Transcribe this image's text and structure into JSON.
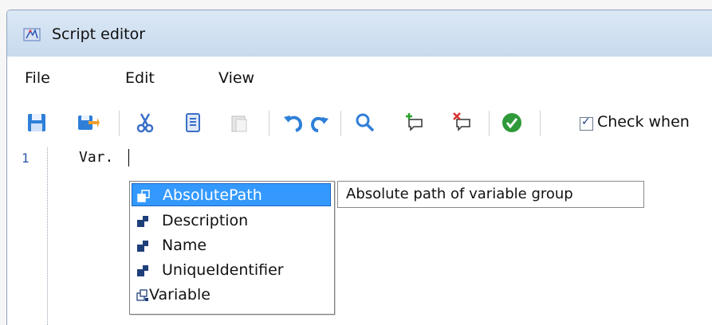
{
  "window": {
    "title": "Script editor"
  },
  "menu": {
    "items": [
      "File",
      "Edit",
      "View"
    ]
  },
  "toolbar": {
    "buttons": [
      "save-icon",
      "save-as-icon",
      "cut-icon",
      "copy-icon",
      "paste-icon",
      "undo-icon",
      "redo-icon",
      "search-icon",
      "add-breakpoint-icon",
      "remove-breakpoint-icon",
      "check-icon"
    ],
    "check_label": "Check when",
    "check_checked": true
  },
  "editor": {
    "line_number": "1",
    "code": "Var."
  },
  "autocomplete": {
    "items": [
      {
        "label": "AbsolutePath",
        "icon": "property-icon",
        "selected": true
      },
      {
        "label": "Description",
        "icon": "property-icon",
        "selected": false
      },
      {
        "label": "Name",
        "icon": "property-icon",
        "selected": false
      },
      {
        "label": "UniqueIdentifier",
        "icon": "property-icon",
        "selected": false
      },
      {
        "label": "Variable",
        "icon": "method-icon",
        "selected": false
      }
    ],
    "tooltip": "Absolute path of variable group"
  },
  "colors": {
    "selection": "#3399ff",
    "titlebar": "#c8daee",
    "line_number": "#2b5aa8"
  }
}
